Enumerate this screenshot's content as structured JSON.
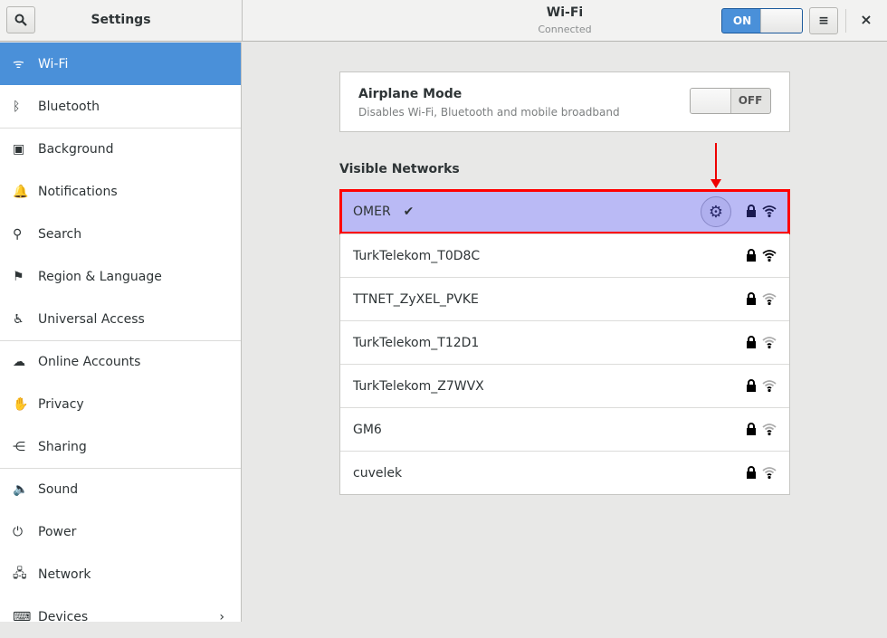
{
  "header": {
    "sidebar_title": "Settings",
    "title": "Wi-Fi",
    "subtitle": "Connected",
    "wifi_toggle": "ON",
    "menu_icon": "≡",
    "close_icon": "×",
    "search_icon": "🔍"
  },
  "sidebar": {
    "items": [
      {
        "label": "Wi-Fi",
        "icon": "wifi",
        "glyph": "ᯤ"
      },
      {
        "label": "Bluetooth",
        "icon": "bluetooth",
        "glyph": "ᛒ"
      },
      {
        "label": "Background",
        "icon": "background",
        "glyph": "▣"
      },
      {
        "label": "Notifications",
        "icon": "bell",
        "glyph": "🔔"
      },
      {
        "label": "Search",
        "icon": "search",
        "glyph": "⚲"
      },
      {
        "label": "Region & Language",
        "icon": "flag",
        "glyph": "⚑"
      },
      {
        "label": "Universal Access",
        "icon": "accessibility",
        "glyph": "♿"
      },
      {
        "label": "Online Accounts",
        "icon": "cloud",
        "glyph": "☁"
      },
      {
        "label": "Privacy",
        "icon": "hand",
        "glyph": "✋"
      },
      {
        "label": "Sharing",
        "icon": "share",
        "glyph": "⋲"
      },
      {
        "label": "Sound",
        "icon": "speaker",
        "glyph": "🔈"
      },
      {
        "label": "Power",
        "icon": "power",
        "glyph": "⏻"
      },
      {
        "label": "Network",
        "icon": "network",
        "glyph": "🖧"
      },
      {
        "label": "Devices",
        "icon": "devices",
        "glyph": "⌨"
      }
    ]
  },
  "airplane": {
    "title": "Airplane Mode",
    "subtitle": "Disables Wi-Fi, Bluetooth and mobile broadband",
    "toggle": "OFF"
  },
  "networks_title": "Visible Networks",
  "networks": [
    {
      "name": "OMER",
      "connected": true,
      "check": "✔",
      "secured": true,
      "signal": 3
    },
    {
      "name": "TurkTelekom_T0D8C",
      "secured": true,
      "signal": 3
    },
    {
      "name": "TTNET_ZyXEL_PVKE",
      "secured": true,
      "signal": 1
    },
    {
      "name": "TurkTelekom_T12D1",
      "secured": true,
      "signal": 1
    },
    {
      "name": "TurkTelekom_Z7WVX",
      "secured": true,
      "signal": 1
    },
    {
      "name": "GM6",
      "secured": true,
      "signal": 1
    },
    {
      "name": "cuvelek",
      "secured": true,
      "signal": 1
    }
  ],
  "colors": {
    "accent": "#4a90d9",
    "selected_row": "#babaf5",
    "highlight": "#ff0000"
  }
}
